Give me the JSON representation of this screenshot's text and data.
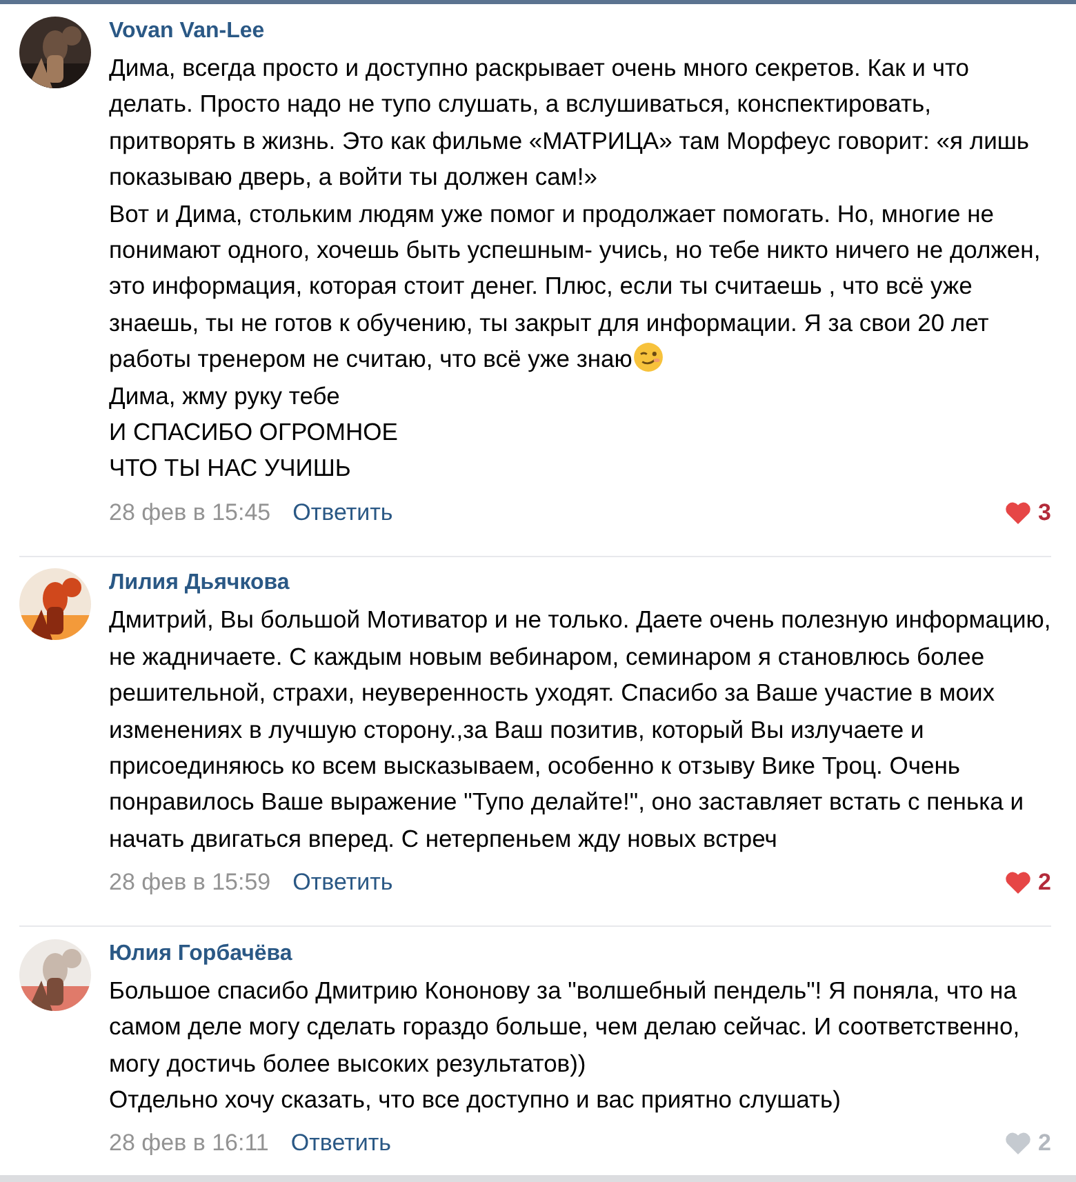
{
  "comments": [
    {
      "author": "Vovan Van-Lee",
      "avatar": {
        "kind": "picture"
      },
      "paragraphs": [
        {
          "text": "Дима, всегда просто и доступно раскрывает очень много секретов. Как и что делать. Просто надо не тупо слушать, а вслушиваться, конспектировать, притворять в жизнь. Это как фильме «МАТРИЦА» там Морфеус говорит: «я лишь показываю дверь, а войти ты должен сам!»",
          "trailing_emoji": false
        },
        {
          "text": "Вот и Дима, стольким людям уже помог и продолжает помогать. Но, многие не понимают одного, хочешь быть успешным- учись, но тебе никто ничего не должен, это информация, которая стоит денег. Плюс, если ты считаешь , что всё уже знаешь, ты не готов к обучению, ты закрыт для информации. Я за свои 20 лет работы тренером не считаю, что всё уже знаю",
          "trailing_emoji": true
        },
        {
          "text": "Дима, жму руку тебе",
          "trailing_emoji": false
        },
        {
          "text": "И СПАСИБО ОГРОМНОЕ",
          "trailing_emoji": false
        },
        {
          "text": "ЧТО ТЫ НАС УЧИШЬ",
          "trailing_emoji": false
        }
      ],
      "date": "28 фев в 15:45",
      "reply": "Ответить",
      "liked": true,
      "likes": "3"
    },
    {
      "author": "Лилия Дьячкова",
      "avatar": {
        "kind": "picture"
      },
      "paragraphs": [
        {
          "text": "Дмитрий, Вы большой Мотиватор и не только. Даете очень полезную информацию, не жадничаете. С каждым новым вебинаром, семинаром я становлюсь более решительной, страхи, неуверенность уходят. Спасибо за Ваше участие в моих изменениях в лучшую сторону.,за Ваш позитив, который Вы излучаете и присоединяюсь ко всем высказываем, особенно к отзыву Вике Троц. Очень понравилось Ваше выражение \"Тупо делайте!\", оно заставляет встать с пенька и начать двигаться вперед. С нетерпеньем жду новых встреч",
          "trailing_emoji": false
        }
      ],
      "date": "28 фев в 15:59",
      "reply": "Ответить",
      "liked": true,
      "likes": "2"
    },
    {
      "author": "Юлия Горбачёва",
      "avatar": {
        "kind": "picture"
      },
      "paragraphs": [
        {
          "text": "Большое спасибо Дмитрию Кононову за \"волшебный пендель\"! Я поняла, что на самом деле могу сделать гораздо больше, чем делаю сейчас. И соответственно, могу достичь более высоких результатов))",
          "trailing_emoji": false
        },
        {
          "text": "Отдельно хочу сказать, что все доступно и вас приятно слушать)",
          "trailing_emoji": false
        }
      ],
      "date": "28 фев в 16:11",
      "reply": "Ответить",
      "liked": false,
      "likes": "2"
    }
  ]
}
